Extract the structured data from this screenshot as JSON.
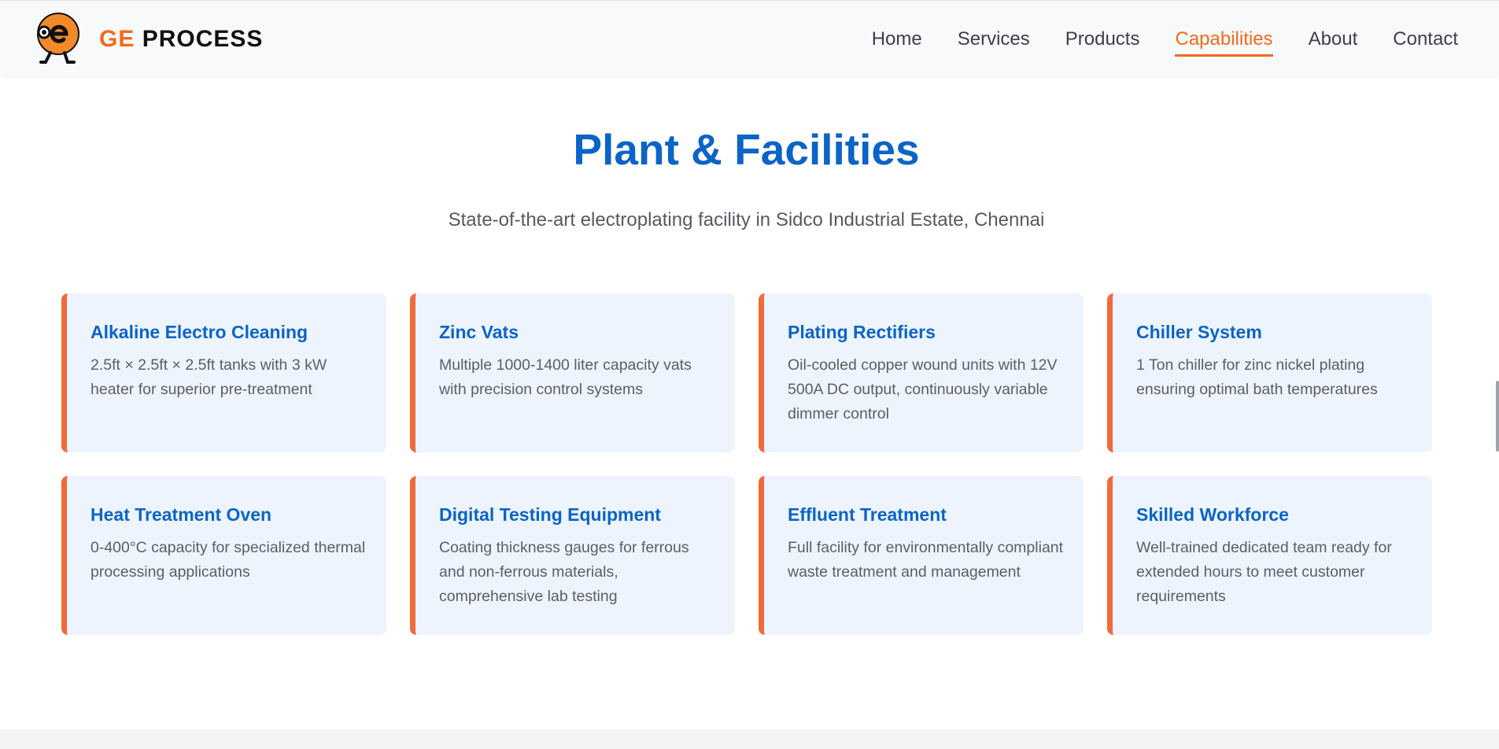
{
  "header": {
    "brand_ge": "GE",
    "brand_process": "PROCESS",
    "nav": [
      {
        "label": "Home"
      },
      {
        "label": "Services"
      },
      {
        "label": "Products"
      },
      {
        "label": "Capabilities",
        "active": true
      },
      {
        "label": "About"
      },
      {
        "label": "Contact"
      }
    ]
  },
  "main": {
    "title": "Plant & Facilities",
    "subtitle": "State-of-the-art electroplating facility in Sidco Industrial Estate, Chennai",
    "cards": [
      {
        "title": "Alkaline Electro Cleaning",
        "desc": "2.5ft × 2.5ft × 2.5ft tanks with 3 kW heater for superior pre-treatment"
      },
      {
        "title": "Zinc Vats",
        "desc": "Multiple 1000-1400 liter capacity vats with precision control systems"
      },
      {
        "title": "Plating Rectifiers",
        "desc": "Oil-cooled copper wound units with 12V 500A DC output, continuously variable dimmer control"
      },
      {
        "title": "Chiller System",
        "desc": "1 Ton chiller for zinc nickel plating ensuring optimal bath temperatures"
      },
      {
        "title": "Heat Treatment Oven",
        "desc": "0-400°C capacity for specialized thermal processing applications"
      },
      {
        "title": "Digital Testing Equipment",
        "desc": "Coating thickness gauges for ferrous and non-ferrous materials, comprehensive lab testing"
      },
      {
        "title": "Effluent Treatment",
        "desc": "Full facility for environmentally compliant waste treatment and management"
      },
      {
        "title": "Skilled Workforce",
        "desc": "Well-trained dedicated team ready for extended hours to meet customer requirements"
      }
    ]
  },
  "colors": {
    "accent_orange": "#f26a1b",
    "primary_blue": "#0b64c7",
    "card_bg": "#edf4fe"
  },
  "icons": {
    "logo": "ge-mascot-logo"
  }
}
